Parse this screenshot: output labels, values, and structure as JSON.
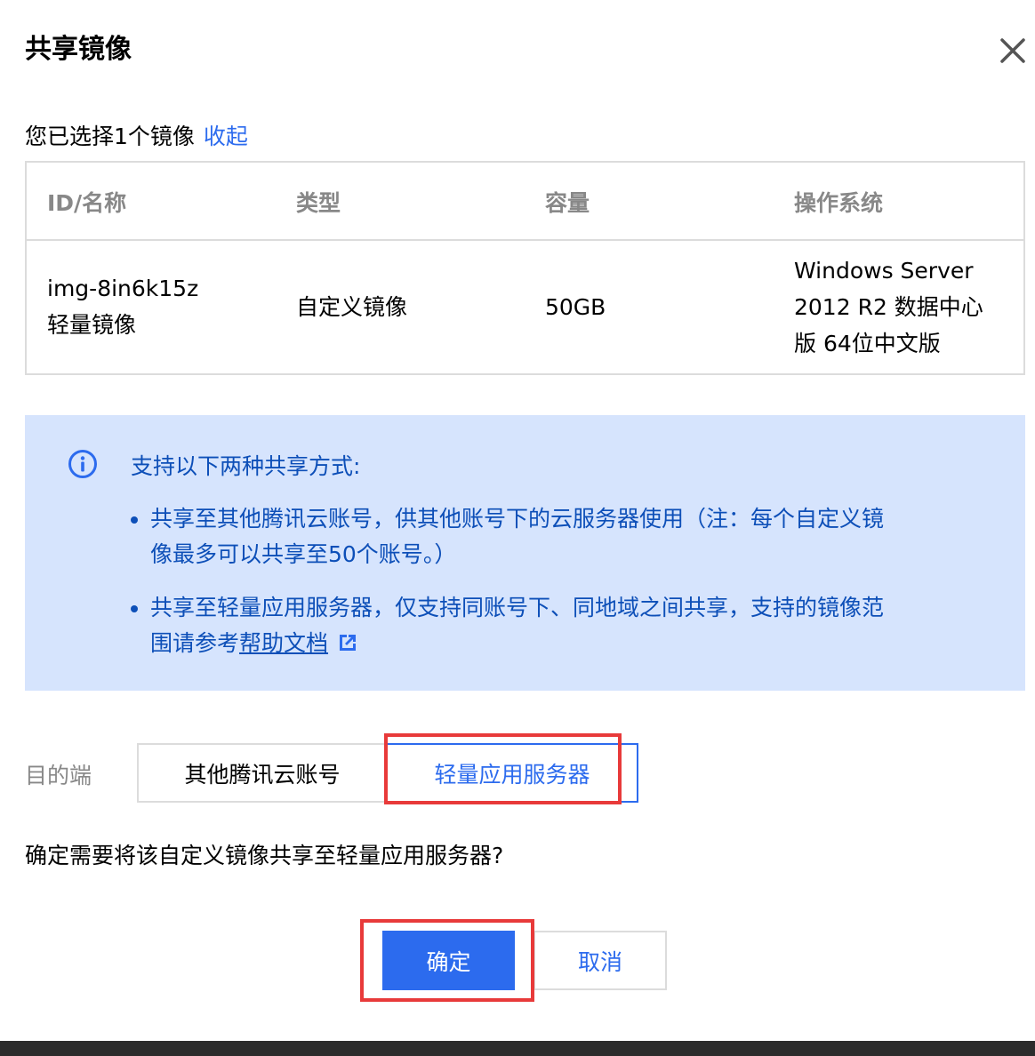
{
  "dialog": {
    "title": "共享镜像",
    "close_icon": "close-icon"
  },
  "selection": {
    "summary": "您已选择1个镜像",
    "collapse_link": "收起"
  },
  "table": {
    "columns": [
      "ID/名称",
      "类型",
      "容量",
      "操作系统"
    ],
    "rows": [
      {
        "id": "img-8in6k15z",
        "name": "轻量镜像",
        "type": "自定义镜像",
        "capacity": "50GB",
        "os_line1": "Windows Server",
        "os_line2": "2012 R2 数据中心",
        "os_line3": "版 64位中文版"
      }
    ]
  },
  "notice": {
    "icon": "info-icon",
    "title": "支持以下两种共享方式:",
    "bullet1_line1": "共享至其他腾讯云账号，供其他账号下的云服务器使用（注：每个自定义镜",
    "bullet1_line2": "像最多可以共享至50个账号。）",
    "bullet2_line1": "共享至轻量应用服务器，仅支持同账号下、同地域之间共享，支持的镜像范",
    "bullet2_line2_prefix": "围请参考",
    "help_link": "帮助文档",
    "external_icon": "external-link-icon"
  },
  "destination": {
    "label": "目的端",
    "options": [
      "其他腾讯云账号",
      "轻量应用服务器"
    ],
    "selected": "轻量应用服务器"
  },
  "confirm_text": "确定需要将该自定义镜像共享至轻量应用服务器?",
  "buttons": {
    "ok": "确定",
    "cancel": "取消"
  },
  "colors": {
    "primary": "#2c6bee",
    "notice_bg": "#d6e4fd",
    "notice_text": "#0d4fb8",
    "highlight": "#e83a3a"
  }
}
